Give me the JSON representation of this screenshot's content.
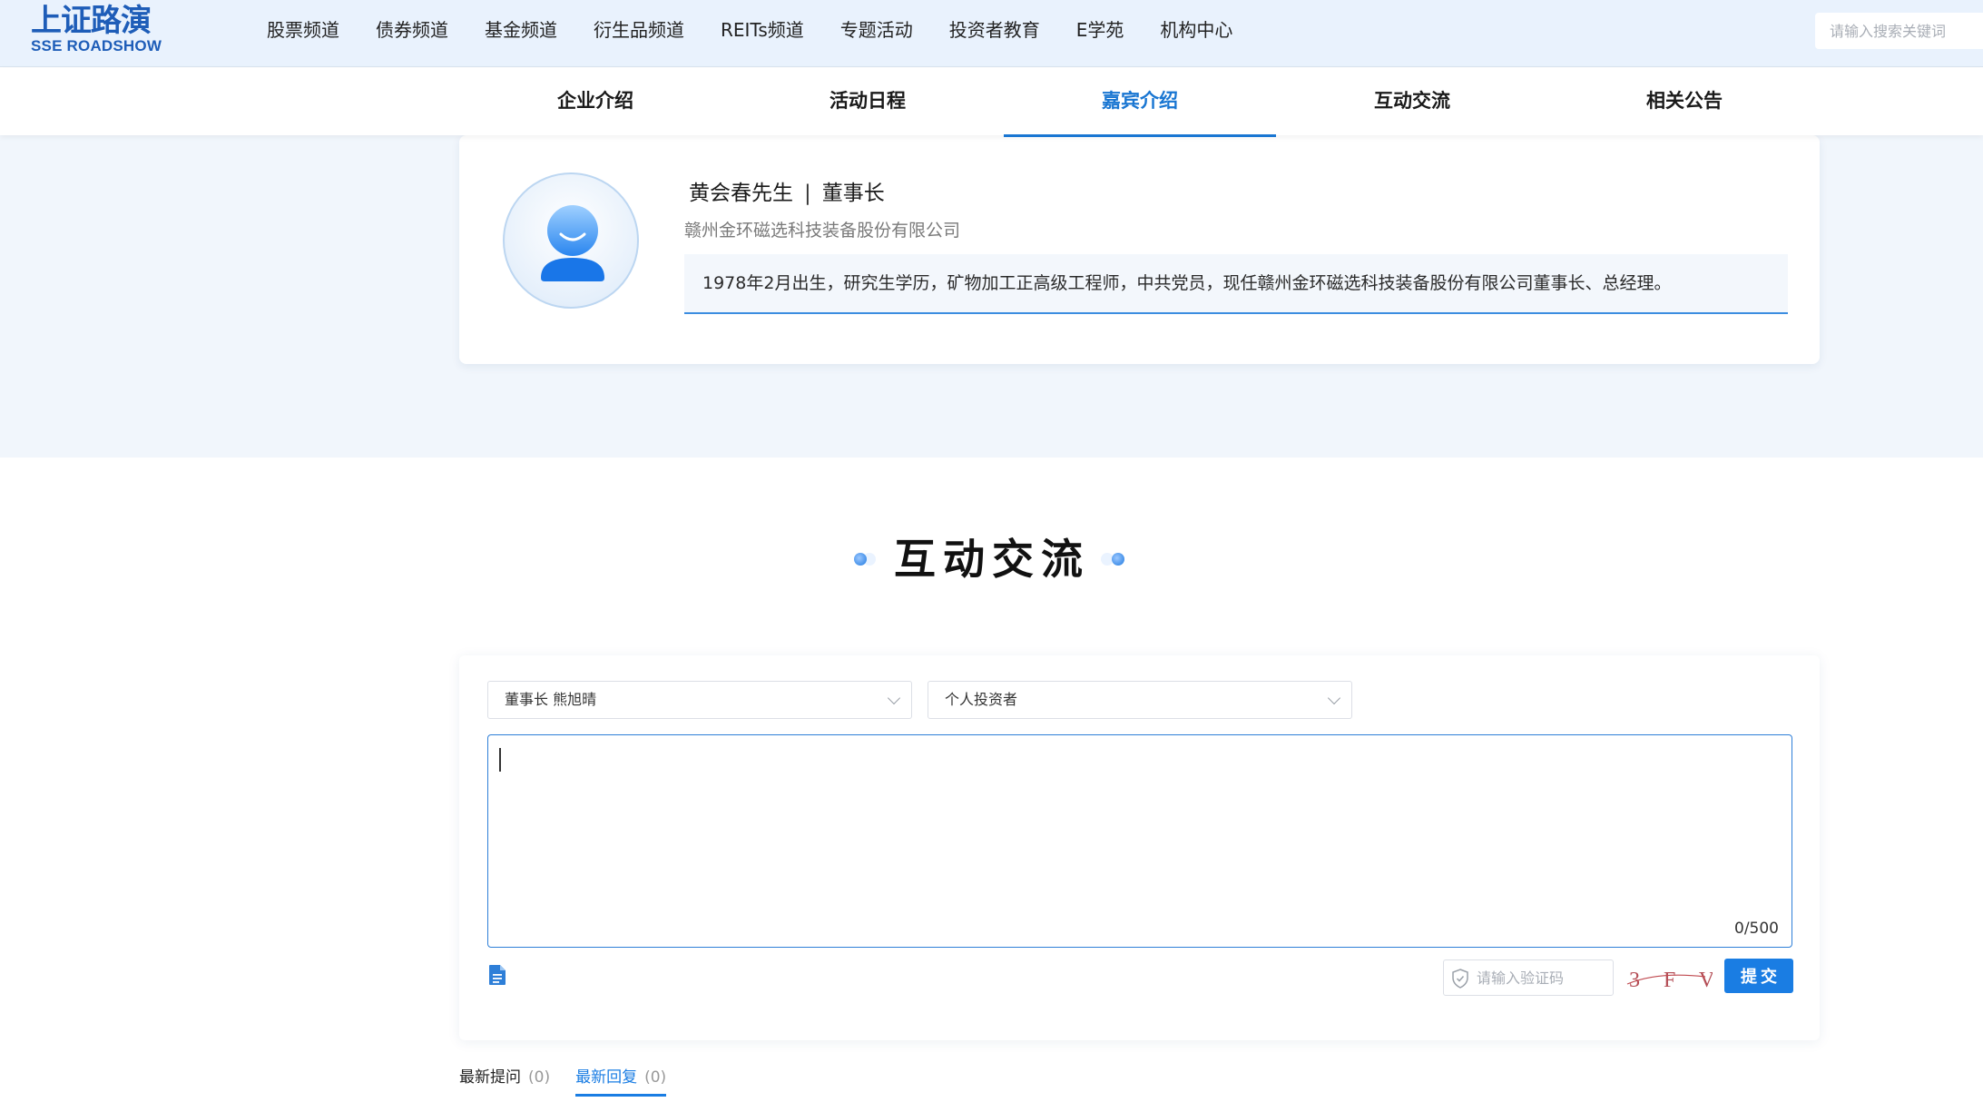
{
  "header": {
    "logo_cn": "上证路演",
    "logo_en": "SSE ROADSHOW",
    "nav": [
      "股票频道",
      "债券频道",
      "基金频道",
      "衍生品频道",
      "REITs频道",
      "专题活动",
      "投资者教育",
      "E学苑",
      "机构中心"
    ],
    "search_placeholder": "请输入搜索关键词"
  },
  "subnav": {
    "tabs": [
      "企业介绍",
      "活动日程",
      "嘉宾介绍",
      "互动交流",
      "相关公告"
    ],
    "active": "嘉宾介绍"
  },
  "guest": {
    "name": "黄会春先生",
    "separator": "|",
    "title": "董事长",
    "company": "赣州金环磁选科技装备股份有限公司",
    "bio": "1978年2月出生，研究生学历，矿物加工正高级工程师，中共党员，现任赣州金环磁选科技装备股份有限公司董事长、总经理。"
  },
  "interaction": {
    "section_title": "互动交流",
    "guest_select": "董事长 熊旭晴",
    "identity_select": "个人投资者",
    "char_count": "0/500",
    "captcha_placeholder": "请输入验证码",
    "captcha_text": "3 F V",
    "submit_label": "提交"
  },
  "qa_tabs": [
    {
      "label": "最新提问",
      "count": "(0)",
      "active": false
    },
    {
      "label": "最新回复",
      "count": "(0)",
      "active": true
    }
  ],
  "colors": {
    "accent": "#1a7de3",
    "header_bg": "#e9f2fd",
    "section_bg": "#f1f6fc"
  }
}
